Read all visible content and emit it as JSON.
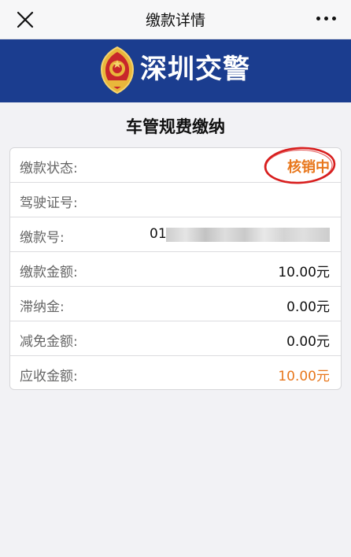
{
  "nav": {
    "title": "缴款详情",
    "close_icon": "close-icon",
    "more_icon": "more-dots-icon"
  },
  "banner": {
    "text": "深圳交警",
    "emblem_icon": "police-emblem-icon",
    "background": "#1b3d8f"
  },
  "page_title": "车管规费缴纳",
  "rows": [
    {
      "label": "缴款状态:",
      "value": "核销中",
      "highlight": true
    },
    {
      "label": "驾驶证号:",
      "value": ""
    },
    {
      "label": "缴款号:",
      "value": "01"
    },
    {
      "label": "缴款金额:",
      "value": "10.00元"
    },
    {
      "label": "滞纳金:",
      "value": "0.00元"
    },
    {
      "label": "减免金额:",
      "value": "0.00元"
    },
    {
      "label": "应收金额:",
      "value": "10.00元",
      "highlight": true
    }
  ],
  "colors": {
    "accent_orange": "#e8771c",
    "annotation_red": "#d81e1e"
  }
}
